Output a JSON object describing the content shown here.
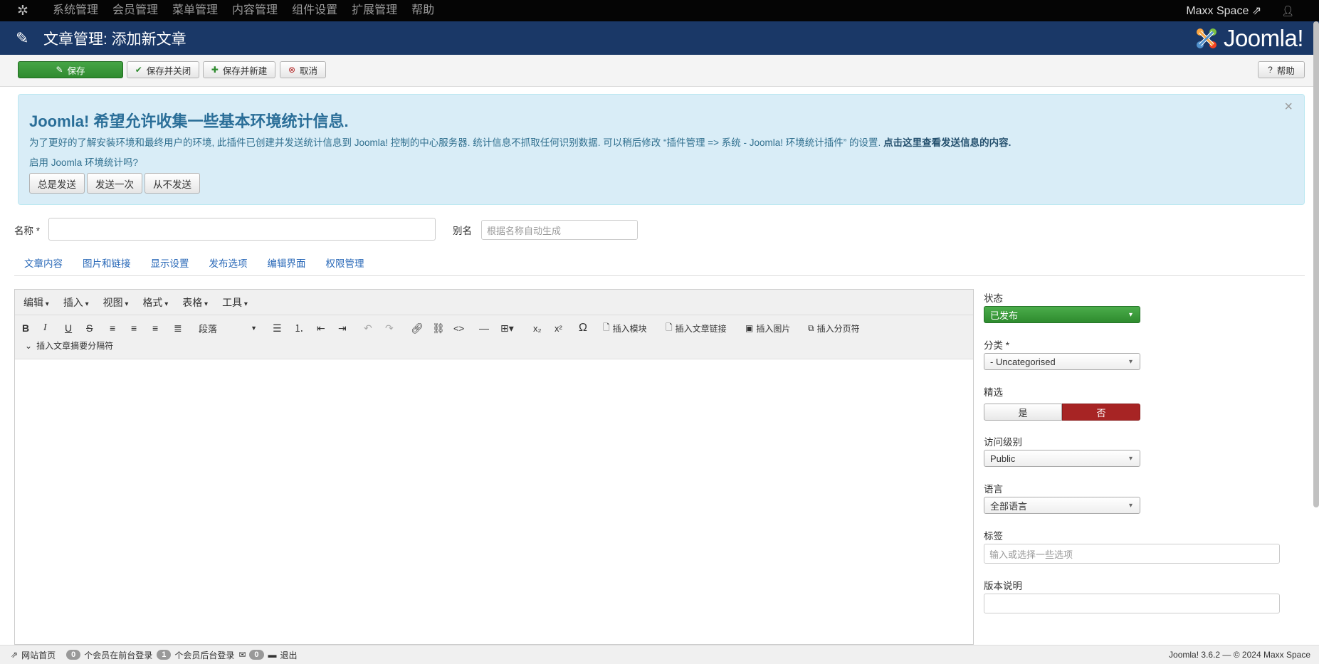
{
  "topnav": {
    "menu": [
      "系统管理",
      "会员管理",
      "菜单管理",
      "内容管理",
      "组件设置",
      "扩展管理",
      "帮助"
    ],
    "site_name": "Maxx Space",
    "icons": {
      "logo": "joomla-icon",
      "external": "external-link-icon",
      "user": "user-icon"
    }
  },
  "header": {
    "title": "文章管理: 添加新文章",
    "brand": "Joomla!"
  },
  "toolbar": {
    "save": "保存",
    "save_close": "保存并关闭",
    "save_new": "保存并新建",
    "cancel": "取消",
    "help": "帮助"
  },
  "alert": {
    "title": "Joomla! 希望允许收集一些基本环境统计信息.",
    "text": "为了更好的了解安装环境和最终用户的环境, 此插件已创建并发送统计信息到 Joomla! 控制的中心服务器. 统计信息不抓取任何识别数据. 可以稍后修改 “插件管理 => 系统 - Joomla!   环境统计插件” 的设置.",
    "link": "点击这里查看发送信息的内容.",
    "question": "启用 Joomla 环境统计吗?",
    "buttons": [
      "总是发送",
      "发送一次",
      "从不发送"
    ],
    "close": "×"
  },
  "form": {
    "name_label": "名称 *",
    "name_value": "",
    "alias_label": "别名",
    "alias_placeholder": "根据名称自动生成"
  },
  "tabs": [
    "文章内容",
    "图片和链接",
    "显示设置",
    "发布选项",
    "编辑界面",
    "权限管理"
  ],
  "editor": {
    "menubar": [
      "编辑",
      "插入",
      "视图",
      "格式",
      "表格",
      "工具"
    ],
    "format_select": "段落",
    "buttons": {
      "insert_module": "插入模块",
      "insert_article_link": "插入文章链接",
      "insert_image": "插入图片",
      "insert_pagebreak": "插入分页符",
      "insert_readmore": "插入文章摘要分隔符"
    }
  },
  "sidebar": {
    "status_label": "状态",
    "status_value": "已发布",
    "category_label": "分类 *",
    "category_value": "- Uncategorised",
    "featured_label": "精选",
    "featured_yes": "是",
    "featured_no": "否",
    "featured_value": "否",
    "access_label": "访问级别",
    "access_value": "Public",
    "language_label": "语言",
    "language_value": "全部语言",
    "tags_label": "标签",
    "tags_placeholder": "输入或选择一些选项",
    "version_label": "版本说明",
    "version_value": ""
  },
  "statusbar": {
    "site_link": "网站首页",
    "frontend_count": "0",
    "frontend_text": "个会员在前台登录",
    "backend_count": "1",
    "backend_text": "个会员后台登录",
    "messages_count": "0",
    "logout": "退出",
    "version": "Joomla! 3.6.2  —  © 2024 Maxx Space"
  },
  "colors": {
    "topbar": "#050505",
    "header": "#1a3867",
    "green": "#3a9a3a",
    "red": "#a72424",
    "link": "#2a69b8",
    "alert_bg": "#d9edf7"
  }
}
